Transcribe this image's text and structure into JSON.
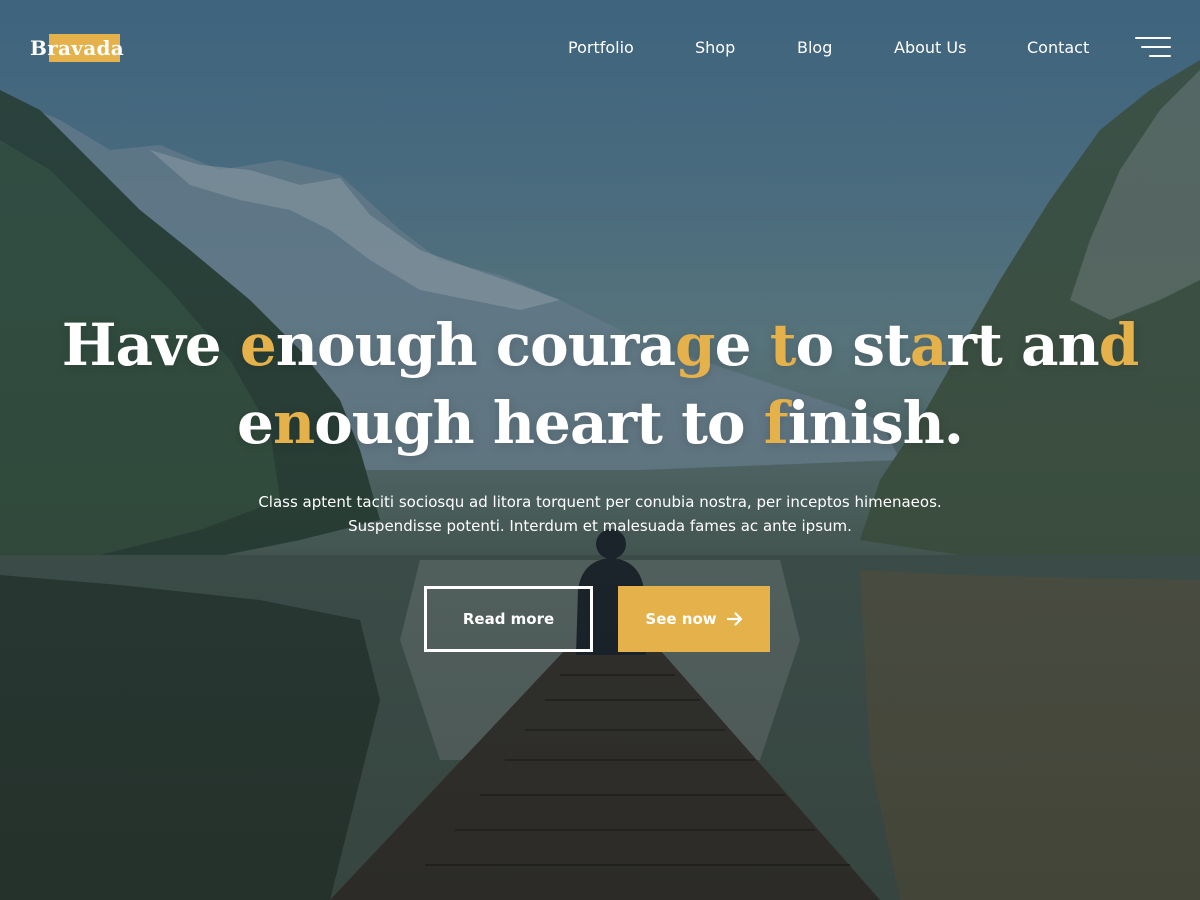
{
  "brand": {
    "name": "Bravada",
    "accent_color": "#e5b14a"
  },
  "nav": {
    "items": [
      {
        "label": "Portfolio"
      },
      {
        "label": "Shop"
      },
      {
        "label": "Blog"
      },
      {
        "label": "About Us"
      },
      {
        "label": "Contact"
      }
    ],
    "menu_icon": "hamburger-menu-icon"
  },
  "hero": {
    "headline_line1": [
      {
        "t": "Have "
      },
      {
        "t": "e",
        "accent": true
      },
      {
        "t": "nough coura"
      },
      {
        "t": "g",
        "accent": true
      },
      {
        "t": "e "
      },
      {
        "t": "t",
        "accent": true
      },
      {
        "t": "o st"
      },
      {
        "t": "a",
        "accent": true
      },
      {
        "t": "rt an"
      },
      {
        "t": "d",
        "accent": true
      }
    ],
    "headline_line2": [
      {
        "t": "e"
      },
      {
        "t": "n",
        "accent": true
      },
      {
        "t": "ough heart to "
      },
      {
        "t": "f",
        "accent": true
      },
      {
        "t": "inish."
      }
    ],
    "subtext_line1": "Class aptent taciti sociosqu ad litora torquent per conubia nostra, per inceptos himenaeos.",
    "subtext_line2": "Suspendisse potenti. Interdum et malesuada fames ac ante ipsum.",
    "primary_button": "Read more",
    "secondary_button": "See now",
    "secondary_button_icon": "arrow-right-icon"
  }
}
